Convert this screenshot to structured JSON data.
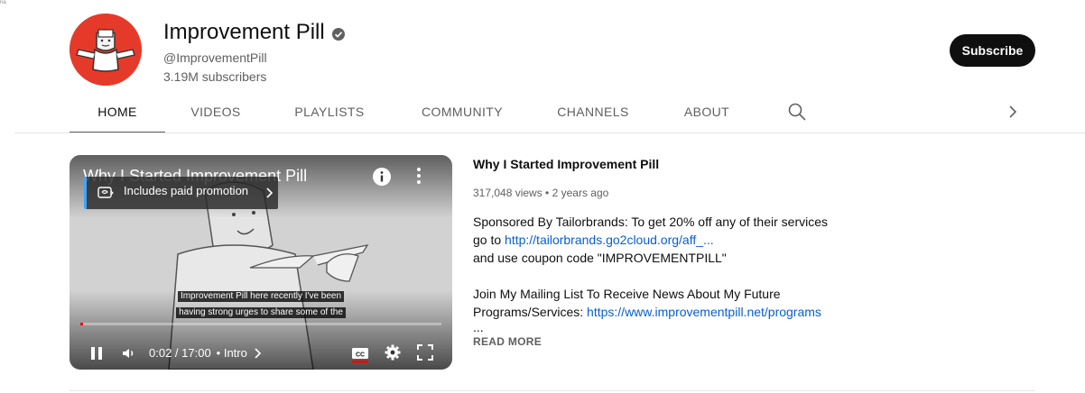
{
  "corner_mark": "na",
  "channel": {
    "name": "Improvement Pill",
    "handle": "@ImprovementPill",
    "subscribers": "3.19M subscribers",
    "subscribe_label": "Subscribe"
  },
  "tabs": [
    {
      "label": "HOME",
      "active": true
    },
    {
      "label": "VIDEOS"
    },
    {
      "label": "PLAYLISTS"
    },
    {
      "label": "COMMUNITY"
    },
    {
      "label": "CHANNELS"
    },
    {
      "label": "ABOUT"
    }
  ],
  "player": {
    "title": "Why I Started Improvement Pill",
    "promo": "Includes paid promotion",
    "caption_line_1": "Improvement Pill here recently I've been",
    "caption_line_2": "having strong urges to share some of the",
    "time": "0:02 / 17:00",
    "chapter": "• Intro",
    "progress_fraction": 0.002
  },
  "video": {
    "title": "Why I Started Improvement Pill",
    "meta": "317,048 views • 2 years ago",
    "desc_1": "Sponsored By Tailorbrands: To get 20% off any of their services",
    "desc_2_prefix": "go to ",
    "desc_2_link": "http://tailorbrands.go2cloud.org/aff_...",
    "desc_3": "and use coupon code \"IMPROVEMENTPILL\"",
    "desc_4": "Join My Mailing List To Receive News About My Future",
    "desc_5_prefix": "Programs/Services: ",
    "desc_5_link": "https://www.improvementpill.net/programs",
    "ellipsis": "...",
    "read_more": "READ MORE"
  },
  "colors": {
    "accent_link": "#065fd4",
    "subscribe_bg": "#0f0f0f",
    "progress": "#ff0000",
    "avatar_bg": "#e53a2a"
  }
}
